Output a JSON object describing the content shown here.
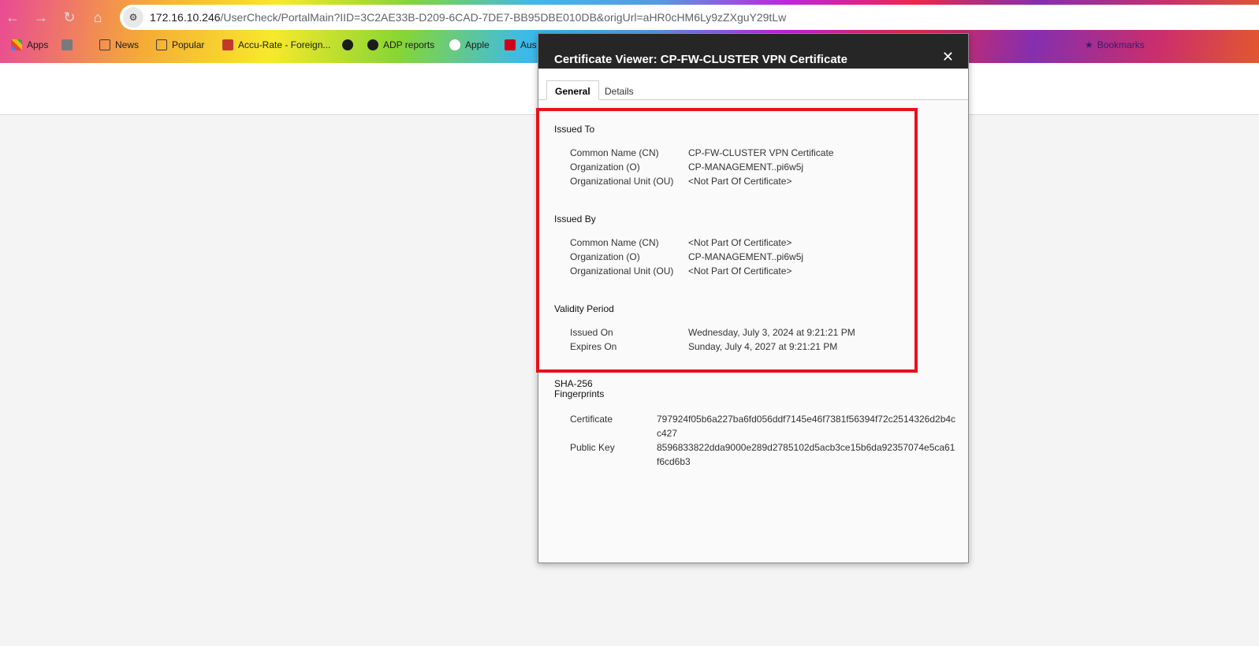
{
  "browser": {
    "address_host": "172.16.10.246",
    "address_path": "/UserCheck/PortalMain?IID=3C2AE33B-D209-6CAD-7DE7-BB95DBE010DB&origUrl=aHR0cHM6Ly9zZXguY29tLw",
    "bookmarks": [
      {
        "label": "Apps",
        "icon": "apps-grid-icon"
      },
      {
        "label": "News",
        "icon": "folder-icon"
      },
      {
        "label": "Popular",
        "icon": "folder-icon"
      },
      {
        "label": "Accu-Rate - Foreign...",
        "icon": "site-icon"
      },
      {
        "label": "ADP reports",
        "icon": "globe-icon"
      },
      {
        "label": "Apple",
        "icon": "apple-icon"
      },
      {
        "label": "Aus",
        "icon": "site-icon"
      }
    ],
    "bookmarks_right": [
      {
        "label": "Bookmarks",
        "icon": "star-icon"
      }
    ]
  },
  "dialog": {
    "title": "Certificate Viewer: CP-FW-CLUSTER VPN Certificate",
    "close_glyph": "✕",
    "tabs": {
      "general": "General",
      "details": "Details"
    },
    "issued_to": {
      "title": "Issued To",
      "rows": [
        {
          "label": "Common Name (CN)",
          "value": "CP-FW-CLUSTER VPN Certificate"
        },
        {
          "label": "Organization (O)",
          "value": "CP-MANAGEMENT..pi6w5j"
        },
        {
          "label": "Organizational Unit (OU)",
          "value": "<Not Part Of Certificate>"
        }
      ]
    },
    "issued_by": {
      "title": "Issued By",
      "rows": [
        {
          "label": "Common Name (CN)",
          "value": "<Not Part Of Certificate>"
        },
        {
          "label": "Organization (O)",
          "value": "CP-MANAGEMENT..pi6w5j"
        },
        {
          "label": "Organizational Unit (OU)",
          "value": "<Not Part Of Certificate>"
        }
      ]
    },
    "validity": {
      "title": "Validity Period",
      "rows": [
        {
          "label": "Issued On",
          "value": "Wednesday, July 3, 2024 at 9:21:21 PM"
        },
        {
          "label": "Expires On",
          "value": "Sunday, July 4, 2027 at 9:21:21 PM"
        }
      ]
    },
    "fingerprints": {
      "title_line1": "SHA-256",
      "title_line2": "Fingerprints",
      "rows": [
        {
          "label": "Certificate",
          "value": "797924f05b6a227ba6fd056ddf7145e46f7381f56394f72c2514326d2b4cc427"
        },
        {
          "label": "Public Key",
          "value": "8596833822dda9000e289d2785102d5acb3ce15b6da92357074e5ca61f6cd6b3"
        }
      ]
    }
  },
  "colors": {
    "highlight": "#e8101a",
    "dialog_header": "#262626"
  }
}
